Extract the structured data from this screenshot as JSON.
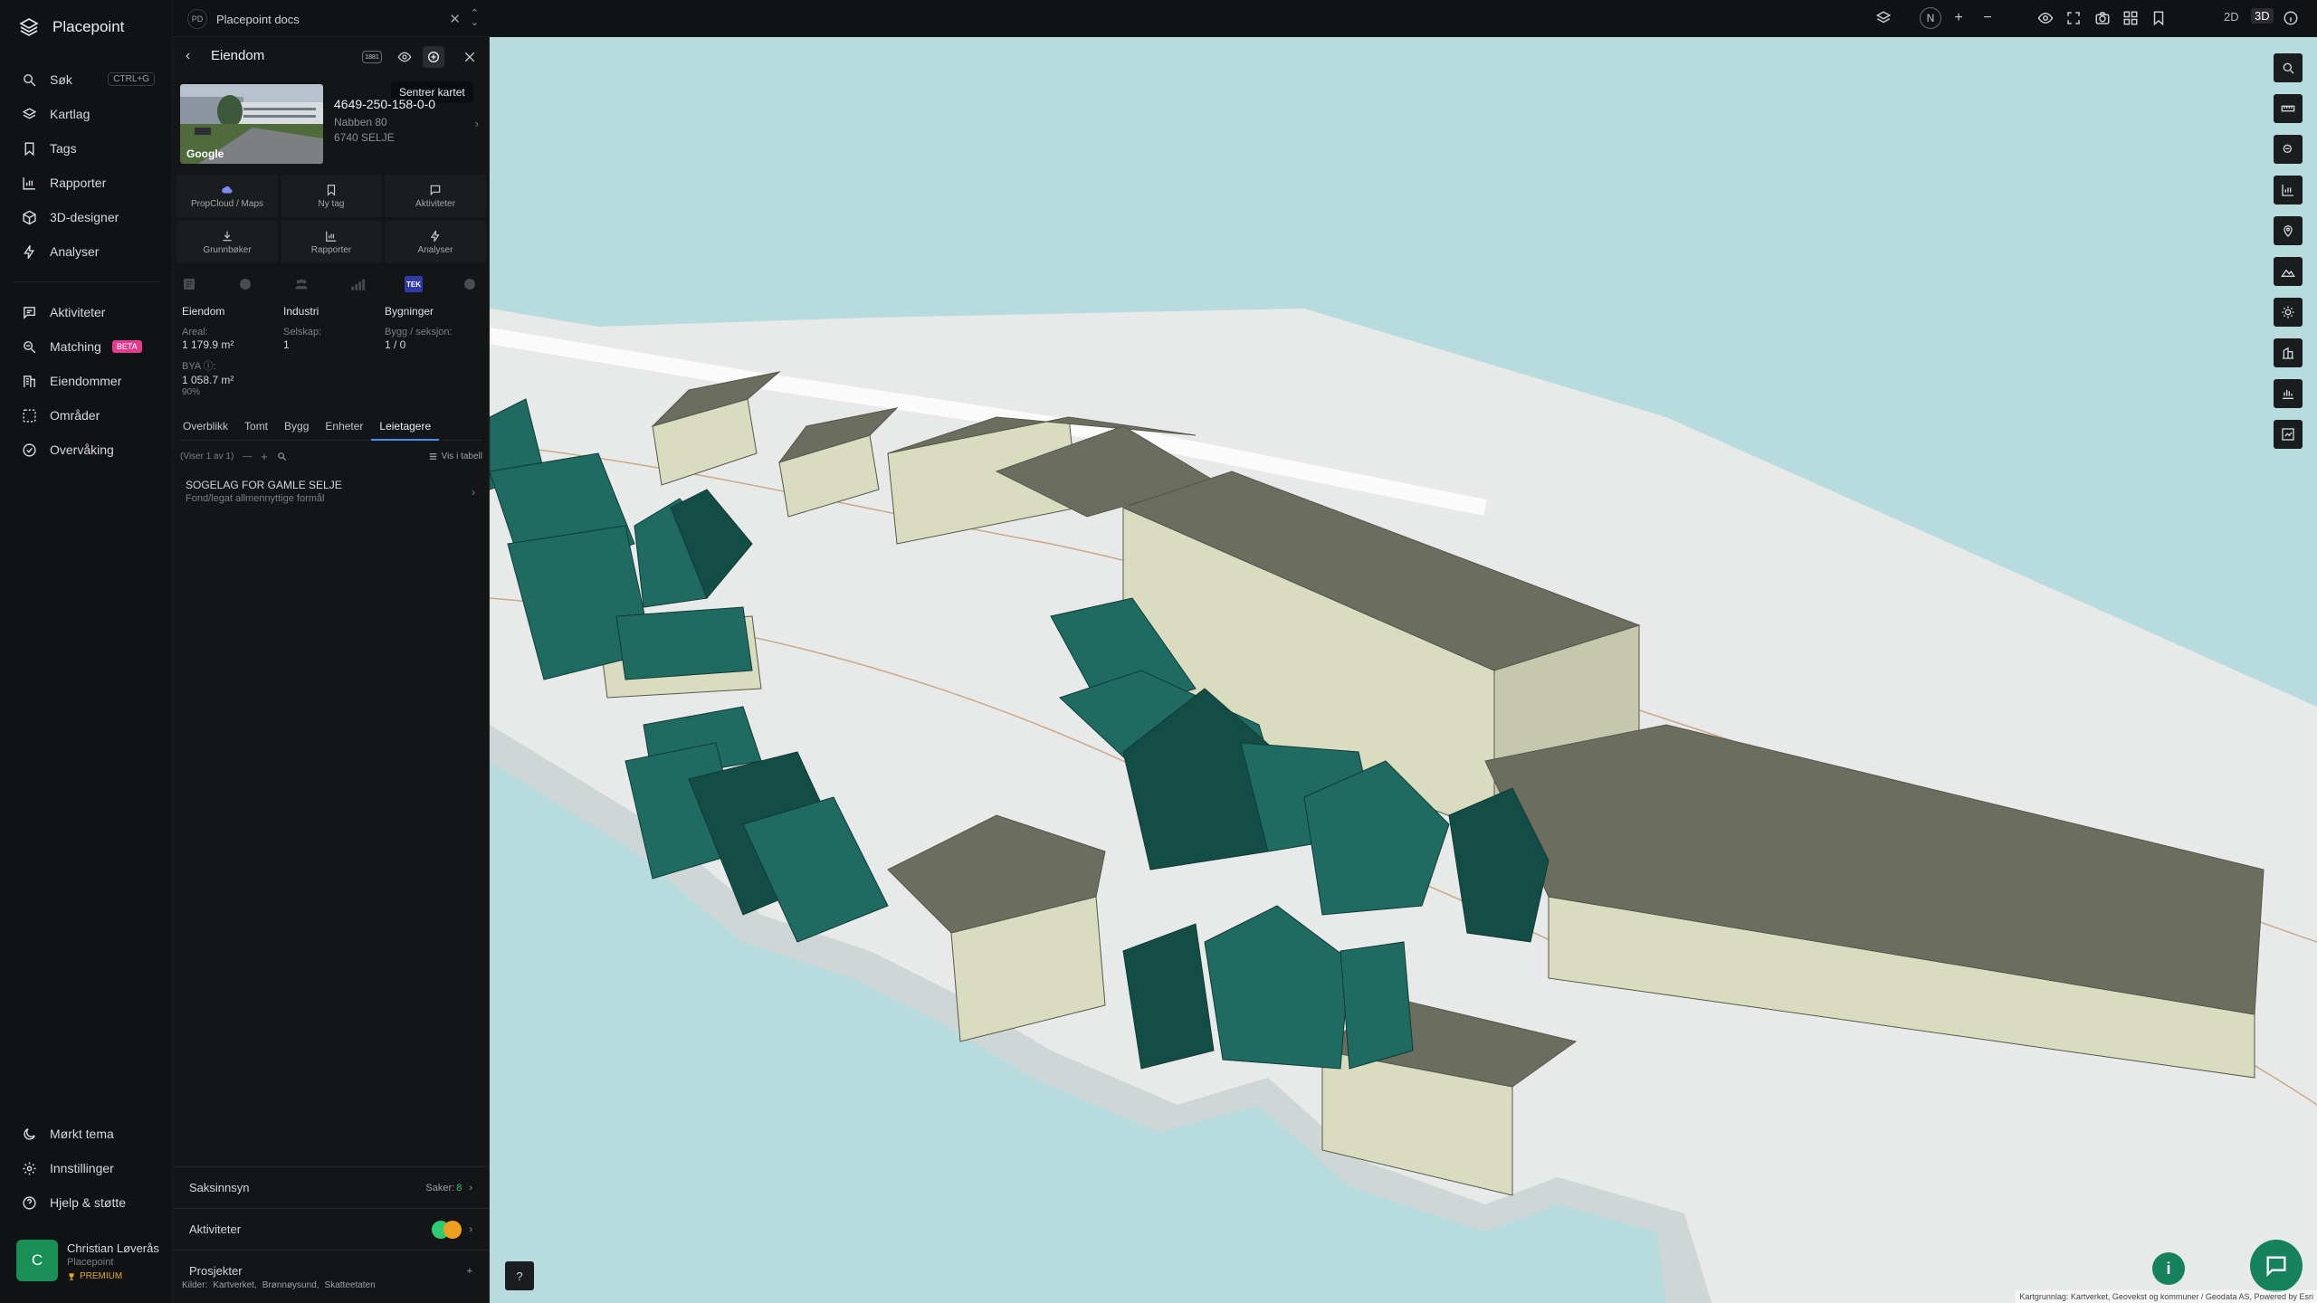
{
  "app": {
    "name": "Placepoint"
  },
  "nav": {
    "search": {
      "label": "Søk",
      "shortcut": "CTRL+G"
    },
    "items_top": [
      {
        "label": "Kartlag",
        "icon": "layers-icon"
      },
      {
        "label": "Tags",
        "icon": "bookmark-icon"
      },
      {
        "label": "Rapporter",
        "icon": "chart-icon"
      },
      {
        "label": "3D-designer",
        "icon": "cube-icon"
      },
      {
        "label": "Analyser",
        "icon": "lightning-icon"
      }
    ],
    "items_mid": [
      {
        "label": "Aktiviteter",
        "icon": "chat-icon"
      },
      {
        "label": "Matching",
        "icon": "match-icon",
        "badge": "BETA"
      },
      {
        "label": "Eiendommer",
        "icon": "building-icon"
      },
      {
        "label": "Områder",
        "icon": "area-icon"
      },
      {
        "label": "Overvåking",
        "icon": "monitor-icon"
      }
    ],
    "items_bottom": [
      {
        "label": "Mørkt tema",
        "icon": "moon-icon"
      },
      {
        "label": "Innstillinger",
        "icon": "gear-icon"
      },
      {
        "label": "Hjelp & støtte",
        "icon": "help-icon"
      }
    ],
    "user": {
      "initial": "C",
      "name": "Christian Løverås",
      "org": "Placepoint",
      "plan": "PREMIUM"
    }
  },
  "topbar": {
    "doc_badge": "PD",
    "doc_title": "Placepoint docs",
    "view_modes": [
      "2D",
      "3D"
    ],
    "active_view": "3D",
    "compass": "N"
  },
  "panel": {
    "title": "Eiendom",
    "header_badge": "1881",
    "tooltip": "Sentrer kartet",
    "photo_credit": "Google",
    "property": {
      "id": "4649-250-158-0-0",
      "address": "Nabben 80",
      "postal": "6740 SELJE"
    },
    "actions": [
      {
        "label": "PropCloud / Maps",
        "icon": "cloud-icon"
      },
      {
        "label": "Ny tag",
        "icon": "bookmark-icon"
      },
      {
        "label": "Aktiviteter",
        "icon": "chat-icon"
      },
      {
        "label": "Grunnbøker",
        "icon": "download-icon"
      },
      {
        "label": "Rapporter",
        "icon": "chart-icon"
      },
      {
        "label": "Analyser",
        "icon": "lightning-icon"
      }
    ],
    "mini_tag": "TEK",
    "stats": {
      "col1": {
        "heading": "Eiendom",
        "label": "Areal:",
        "value": "1 179.9 m²",
        "label2": "BYA ⓘ:",
        "value2": "1 058.7 m²",
        "sub": "90%"
      },
      "col2": {
        "heading": "Industri",
        "label": "Selskap:",
        "value": "1"
      },
      "col3": {
        "heading": "Bygninger",
        "label": "Bygg / seksjon:",
        "value": "1 / 0"
      }
    },
    "tabs": [
      "Overblikk",
      "Tomt",
      "Bygg",
      "Enheter",
      "Leietagere"
    ],
    "active_tab": "Leietagere",
    "list": {
      "count_text": "(Viser 1 av 1)",
      "table_label": "Vis i tabell"
    },
    "tenant": {
      "name": "SOGELAG FOR GAMLE SELJE",
      "type": "Fond/legat allmennyttige formål"
    },
    "sections": {
      "saksinnsyn": {
        "label": "Saksinnsyn",
        "meta_label": "Saker:",
        "meta_value": "8"
      },
      "aktiviteter": {
        "label": "Aktiviteter"
      },
      "prosjekter": {
        "label": "Prosjekter",
        "action": "+"
      }
    },
    "sources": {
      "label": "Kilder:",
      "items": [
        "Kartverket,",
        "Brønnøysund,",
        "Skatteetaten"
      ]
    }
  },
  "map": {
    "attribution": "Kartgrunnlag: Kartverket, Geovekst og kommuner / Geodata AS, Powered by Esri",
    "colors": {
      "water": "#b8dcde",
      "land": "#e8eaea",
      "teal_building": "#1f6b62",
      "olive_roof": "#6b6d5e",
      "beige_wall": "#d9dcbf"
    }
  }
}
